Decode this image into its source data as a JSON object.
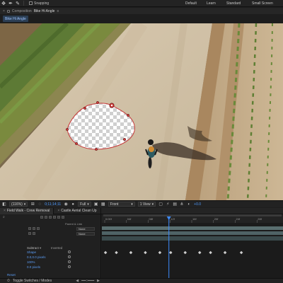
{
  "toolbar": {
    "snapping_label": "Snapping",
    "workspaces": [
      "Default",
      "Learn",
      "Standard",
      "Small Screen"
    ]
  },
  "comp_panel": {
    "header_label": "Composition",
    "comp_name": "Bike Hi Angle",
    "tab_label": "Bike Hi Angle"
  },
  "viewer_footer": {
    "zoom": "(116%)",
    "timecode": "0;11;14;11",
    "resolution": "Full",
    "view": "Front",
    "views": "1 View",
    "exposure": "+0.0"
  },
  "timeline": {
    "tabs": [
      {
        "label": "Field Walk - Crew Removal"
      },
      {
        "label": "Castle Aerial Clean Up"
      }
    ],
    "column_header": "Parent & Link",
    "parent_options": [
      "None",
      "None"
    ],
    "properties": {
      "mask_mode": "Subtract",
      "inverted_label": "Inverted",
      "shape_label": "Shape",
      "feather": "0.0,0.0 pixels",
      "opacity": "100%",
      "expansion": "0.0 pixels",
      "reset_label": "Reset"
    },
    "ruler_labels": [
      "0:00f",
      "04f",
      "08f",
      "12f",
      "16f",
      "20f",
      "24f",
      "28f"
    ],
    "keyframe_positions": [
      0.02,
      0.08,
      0.16,
      0.24,
      0.32,
      0.38,
      0.46,
      0.54,
      0.6,
      0.68,
      0.77
    ],
    "playhead_position": 0.37
  },
  "bottom_bar": {
    "label": "Toggle Switches / Modes"
  }
}
